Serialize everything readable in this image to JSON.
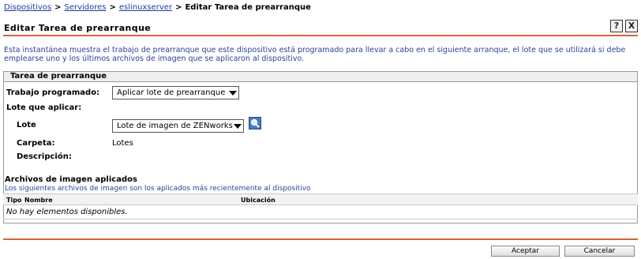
{
  "breadcrumb": {
    "items": [
      "Dispositivos",
      "Servidores",
      "eslinuxserver"
    ],
    "current": "Editar Tarea de prearranque"
  },
  "page": {
    "title": "Editar Tarea de prearranque",
    "help_icon": "?",
    "close_icon": "X",
    "intro": "Esta instantánea muestra el trabajo de prearranque que este dispositivo está programado para llevar a cabo en el siguiente arranque, el lote que se utilizará si debe emplearse uno y los últimos archivos de imagen que se aplicaron al dispositivo."
  },
  "panel": {
    "header": "Tarea de prearranque",
    "scheduled_label": "Trabajo programado:",
    "scheduled_value": "Aplicar lote de prearranque",
    "bundle_section_label": "Lote que aplicar:",
    "bundle_label": "Lote",
    "bundle_value": "Lote de imagen de ZENworks",
    "folder_label": "Carpeta:",
    "folder_value": "Lotes",
    "description_label": "Descripción:",
    "description_value": ""
  },
  "images": {
    "title": "Archivos de imagen aplicados",
    "subtitle": "Los siguientes archivos de imagen son los aplicados más recientemente al dispositivo",
    "columns": [
      "Tipo",
      "Nombre",
      "Ubicación"
    ],
    "empty": "No hay elementos disponibles."
  },
  "footer": {
    "ok_label": "Aceptar",
    "cancel_label": "Cancelar"
  },
  "colors": {
    "accent": "#d6643a",
    "link": "#1f3c9c"
  },
  "icons": {
    "search": "search-icon",
    "help": "help-icon",
    "close": "close-icon"
  }
}
